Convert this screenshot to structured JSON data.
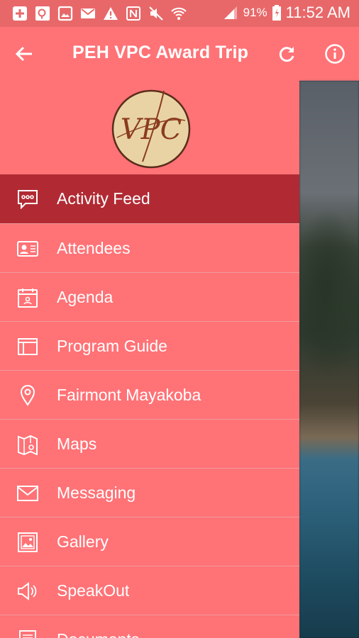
{
  "status_bar": {
    "battery_pct": "91%",
    "time": "11:52 AM",
    "icons": [
      "add-box-icon",
      "search-box-icon",
      "image-icon",
      "mail-icon",
      "warning-icon",
      "nfc-icon",
      "mute-icon",
      "wifi-icon",
      "signal-icon",
      "battery-icon"
    ]
  },
  "header": {
    "title": "PEH VPC Award Trip",
    "back_icon": "back-arrow-icon",
    "refresh_icon": "refresh-icon",
    "info_icon": "info-icon"
  },
  "logo": {
    "monogram": "VPC"
  },
  "menu": {
    "items": [
      {
        "label": "Activity Feed",
        "icon": "chat-bubble-icon",
        "active": true
      },
      {
        "label": "Attendees",
        "icon": "id-card-icon"
      },
      {
        "label": "Agenda",
        "icon": "calendar-icon"
      },
      {
        "label": "Program Guide",
        "icon": "book-icon"
      },
      {
        "label": "Fairmont Mayakoba",
        "icon": "location-pin-icon"
      },
      {
        "label": "Maps",
        "icon": "map-icon"
      },
      {
        "label": "Messaging",
        "icon": "envelope-icon"
      },
      {
        "label": "Gallery",
        "icon": "picture-icon"
      },
      {
        "label": "SpeakOut",
        "icon": "megaphone-icon"
      },
      {
        "label": "Documents",
        "icon": "document-icon"
      }
    ]
  },
  "colors": {
    "status_bar": "#e8686a",
    "primary": "#ff7276",
    "active_item": "#b12a33",
    "logo_bg": "#e9d3a4",
    "logo_ink": "#8a3b1e"
  }
}
